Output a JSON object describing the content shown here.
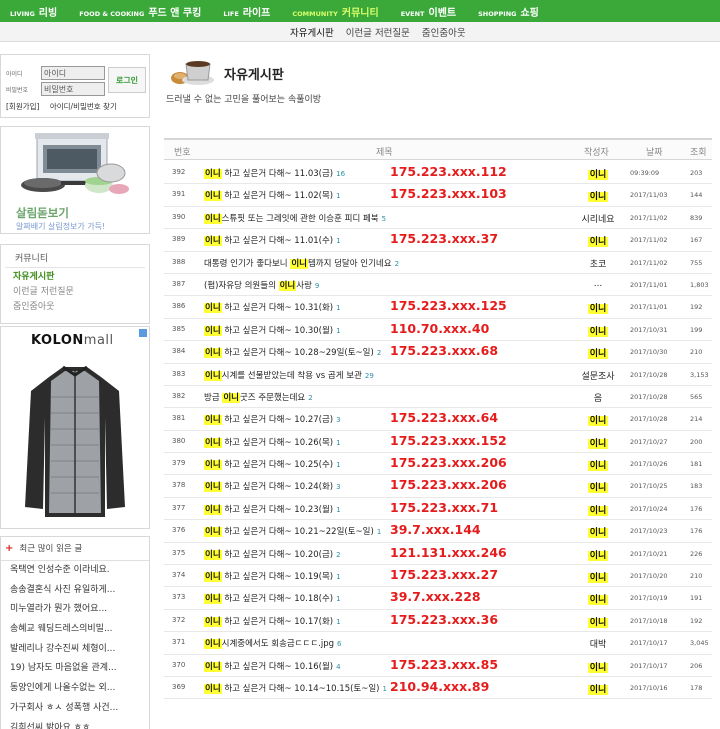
{
  "topnav": [
    {
      "en": "LIVING",
      "kr": "리빙",
      "active": false
    },
    {
      "en": "FOOD & COOKING",
      "kr": "푸드 앤 쿠킹",
      "active": false
    },
    {
      "en": "LIFE",
      "kr": "라이프",
      "active": false
    },
    {
      "en": "COMMUNITY",
      "kr": "커뮤니티",
      "active": true
    },
    {
      "en": "EVENT",
      "kr": "이벤트",
      "active": false
    },
    {
      "en": "SHOPPING",
      "kr": "쇼핑",
      "active": false
    }
  ],
  "subnav": [
    "자유게시판",
    "이런글 저런질문",
    "줌인줌아웃"
  ],
  "login": {
    "id_label": "아이디",
    "pw_label": "비밀번호",
    "id_value": "아이디",
    "pw_value": "비밀번호",
    "button": "로그인",
    "join": "[회원가입]",
    "find": "아이디/비밀번호 찾기"
  },
  "promo": {
    "title": "살림돋보기",
    "subtitle": "알짜배기 살림정보가 가득!"
  },
  "community": {
    "title": "커뮤니티",
    "items": [
      "자유게시판",
      "이런글 저런질문",
      "줌인줌아웃"
    ]
  },
  "ad": {
    "brand": "KOLON",
    "brand_suffix": "mall"
  },
  "popular": {
    "title": "최근 많이 읽은 글",
    "items": [
      "옥택연 인성수준 이라네요.",
      "송송결혼식 사진 유일하게...",
      "미누열라가 뭔가 했어요...",
      "송혜교 웨딩드레스의비밀...",
      "발레리나 강수진씨 체형이...",
      "19) 남자도 마음없을 관계...",
      "동양인에게 나올수없는 외...",
      "가구회사 ㅎㅅ 성폭행 사건...",
      "김희선씨 밝아요 ㅎㅎ",
      "김주혁씨 차량 블랙박스"
    ]
  },
  "board": {
    "title": "자유게시판",
    "desc": "드러낼 수 없는 고민을 풀어보는 속풀이방",
    "headers": {
      "no": "번호",
      "subject": "제목",
      "author": "작성자",
      "date": "날짜",
      "views": "조회"
    },
    "highlight_color": "#ffff33",
    "ip_color": "#e61c1c",
    "rows": [
      {
        "no": "392",
        "hl": "이니",
        "text": " 하고 싶은거 다해~ 11.03(금)",
        "cnt": "16",
        "ip": "175.223.xxx.112",
        "author": "이니",
        "author_hl": true,
        "date": "09:39:09",
        "views": "203"
      },
      {
        "no": "391",
        "hl": "이니",
        "text": " 하고 싶은거 다해~ 11.02(목)",
        "cnt": "1",
        "ip": "175.223.xxx.103",
        "author": "이니",
        "author_hl": true,
        "date": "2017/11/03",
        "views": "144"
      },
      {
        "no": "390",
        "hl": "이니",
        "text": "스튜핏 또는 그레잇에 관한 이승훈 피디 페북",
        "cnt": "5",
        "ip": "",
        "author": "시리네요",
        "author_hl": false,
        "date": "2017/11/02",
        "views": "839"
      },
      {
        "no": "389",
        "hl": "이니",
        "text": " 하고 싶은거 다해~ 11.01(수)",
        "cnt": "1",
        "ip": "175.223.xxx.37",
        "author": "이니",
        "author_hl": true,
        "date": "2017/11/02",
        "views": "167"
      },
      {
        "no": "388",
        "pre": "대통령 인기가 좋다보니 ",
        "hl": "이니",
        "text": "템까지 덩달아 인기네요",
        "cnt": "2",
        "ip": "",
        "author": "초코",
        "author_hl": false,
        "date": "2017/11/02",
        "views": "755"
      },
      {
        "no": "387",
        "pre": "(펌)자유당 의원들의 ",
        "hl": "이니",
        "text": "사랑",
        "cnt": "9",
        "ip": "",
        "author": "...",
        "author_hl": false,
        "date": "2017/11/01",
        "views": "1,803"
      },
      {
        "no": "386",
        "hl": "이니",
        "text": " 하고 싶은거 다해~ 10.31(화)",
        "cnt": "1",
        "ip": "175.223.xxx.125",
        "author": "이니",
        "author_hl": true,
        "date": "2017/11/01",
        "views": "192"
      },
      {
        "no": "385",
        "hl": "이니",
        "text": " 하고 싶은거 다해~ 10.30(월)",
        "cnt": "1",
        "ip": "110.70.xxx.40",
        "author": "이니",
        "author_hl": true,
        "date": "2017/10/31",
        "views": "199"
      },
      {
        "no": "384",
        "hl": "이니",
        "text": " 하고 싶은거 다해~ 10.28~29일(토~일)",
        "cnt": "2",
        "ip": "175.223.xxx.68",
        "author": "이니",
        "author_hl": true,
        "date": "2017/10/30",
        "views": "210"
      },
      {
        "no": "383",
        "hl": "이니",
        "text": "시계를 선물받았는데 착용 vs 곱게 보관",
        "cnt": "29",
        "ip": "",
        "author": "설문조사",
        "author_hl": false,
        "date": "2017/10/28",
        "views": "3,153"
      },
      {
        "no": "382",
        "pre": "방금 ",
        "hl": "이니",
        "text": "굿즈 주문했는데요",
        "cnt": "2",
        "ip": "",
        "author": "음",
        "author_hl": false,
        "date": "2017/10/28",
        "views": "565"
      },
      {
        "no": "381",
        "hl": "이니",
        "text": " 하고 싶은거 다해~ 10.27(금)",
        "cnt": "3",
        "ip": "175.223.xxx.64",
        "author": "이니",
        "author_hl": true,
        "date": "2017/10/28",
        "views": "214"
      },
      {
        "no": "380",
        "hl": "이니",
        "text": " 하고 싶은거 다해~ 10.26(목)",
        "cnt": "1",
        "ip": "175.223.xxx.152",
        "author": "이니",
        "author_hl": true,
        "date": "2017/10/27",
        "views": "200"
      },
      {
        "no": "379",
        "hl": "이니",
        "text": " 하고 싶은거 다해~ 10.25(수)",
        "cnt": "1",
        "ip": "175.223.xxx.206",
        "author": "이니",
        "author_hl": true,
        "date": "2017/10/26",
        "views": "181"
      },
      {
        "no": "378",
        "hl": "이니",
        "text": " 하고 싶은거 다해~ 10.24(화)",
        "cnt": "3",
        "ip": "175.223.xxx.206",
        "author": "이니",
        "author_hl": true,
        "date": "2017/10/25",
        "views": "183"
      },
      {
        "no": "377",
        "hl": "이니",
        "text": " 하고 싶은거 다해~ 10.23(월)",
        "cnt": "1",
        "ip": "175.223.xxx.71",
        "author": "이니",
        "author_hl": true,
        "date": "2017/10/24",
        "views": "176"
      },
      {
        "no": "376",
        "hl": "이니",
        "text": " 하고 싶은거 다해~ 10.21~22일(토~일)",
        "cnt": "1",
        "ip": "39.7.xxx.144",
        "author": "이니",
        "author_hl": true,
        "date": "2017/10/23",
        "views": "176"
      },
      {
        "no": "375",
        "hl": "이니",
        "text": " 하고 싶은거 다해~ 10.20(금)",
        "cnt": "2",
        "ip": "121.131.xxx.246",
        "author": "이니",
        "author_hl": true,
        "date": "2017/10/21",
        "views": "226"
      },
      {
        "no": "374",
        "hl": "이니",
        "text": " 하고 싶은거 다해~ 10.19(목)",
        "cnt": "1",
        "ip": "175.223.xxx.27",
        "author": "이니",
        "author_hl": true,
        "date": "2017/10/20",
        "views": "210"
      },
      {
        "no": "373",
        "hl": "이니",
        "text": " 하고 싶은거 다해~ 10.18(수)",
        "cnt": "1",
        "ip": "39.7.xxx.228",
        "author": "이니",
        "author_hl": true,
        "date": "2017/10/19",
        "views": "191"
      },
      {
        "no": "372",
        "hl": "이니",
        "text": " 하고 싶은거 다해~ 10.17(화)",
        "cnt": "1",
        "ip": "175.223.xxx.36",
        "author": "이니",
        "author_hl": true,
        "date": "2017/10/18",
        "views": "192"
      },
      {
        "no": "371",
        "hl": "이니",
        "text": "시계중에서도 회송금ㄷㄷㄷ.jpg",
        "cnt": "6",
        "ip": "",
        "author": "대박",
        "author_hl": false,
        "date": "2017/10/17",
        "views": "3,045"
      },
      {
        "no": "370",
        "hl": "이니",
        "text": " 하고 싶은거 다해~ 10.16(월)",
        "cnt": "4",
        "ip": "175.223.xxx.85",
        "author": "이니",
        "author_hl": true,
        "date": "2017/10/17",
        "views": "206"
      },
      {
        "no": "369",
        "hl": "이니",
        "text": " 하고 싶은거 다해~ 10.14~10.15(토~일)",
        "cnt": "1",
        "ip": "210.94.xxx.89",
        "author": "이니",
        "author_hl": true,
        "date": "2017/10/16",
        "views": "178"
      }
    ]
  }
}
